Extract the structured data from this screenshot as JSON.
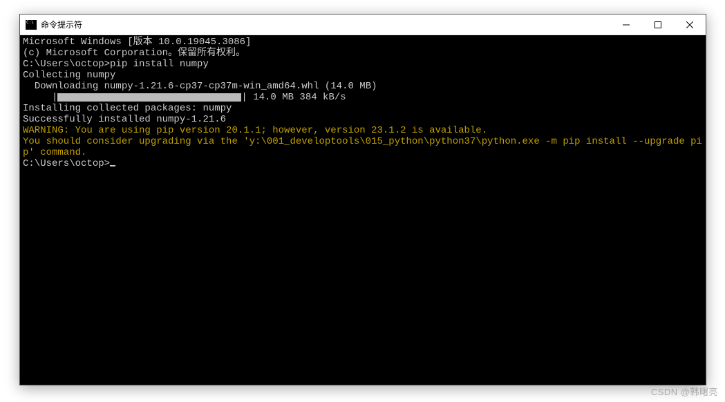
{
  "window": {
    "title": "命令提示符"
  },
  "terminal": {
    "lines": [
      {
        "text": "Microsoft Windows [版本 10.0.19045.3086]",
        "cls": ""
      },
      {
        "text": "(c) Microsoft Corporation。保留所有权利。",
        "cls": ""
      },
      {
        "text": "",
        "cls": ""
      },
      {
        "text": "C:\\Users\\octop>pip install numpy",
        "cls": ""
      },
      {
        "text": "Collecting numpy",
        "cls": ""
      },
      {
        "text": "  Downloading numpy-1.21.6-cp37-cp37m-win_amd64.whl (14.0 MB)",
        "cls": ""
      }
    ],
    "progress": {
      "indent": "     |",
      "suffix": "| 14.0 MB 384 kB/s"
    },
    "lines2": [
      {
        "text": "Installing collected packages: numpy",
        "cls": ""
      },
      {
        "text": "Successfully installed numpy-1.21.6",
        "cls": ""
      },
      {
        "text": "WARNING: You are using pip version 20.1.1; however, version 23.1.2 is available.",
        "cls": "warn"
      },
      {
        "text": "You should consider upgrading via the 'y:\\001_developtools\\015_python\\python37\\python.exe -m pip install --upgrade pip' command.",
        "cls": "warn"
      },
      {
        "text": "",
        "cls": ""
      }
    ],
    "prompt": "C:\\Users\\octop>"
  },
  "watermark": "CSDN @韩曙亮"
}
